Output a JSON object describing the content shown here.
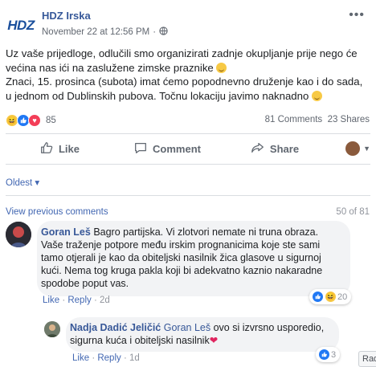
{
  "post": {
    "page_name": "HDZ Irska",
    "logo_text": "HDZ",
    "timestamp": "November 22 at 12:56 PM",
    "more": "•••",
    "text_line1": "Uz vaše prijedloge, odlučili smo organizirati zadnje okupljanje prije nego će većina nas ići na zaslužene zimske praznike",
    "text_line2": "Znaci, 15. prosinca (subota) imat ćemo popodnevno druženje kao i do sada, u jednom od Dublinskih pubova. Točnu lokaciju javimo naknadno",
    "reaction_count": "85",
    "comments_count": "81 Comments",
    "shares_count": "23 Shares"
  },
  "actions": {
    "like": "Like",
    "comment": "Comment",
    "share": "Share"
  },
  "comments_section": {
    "sort_label": "Oldest ▾",
    "view_previous": "View previous comments",
    "count": "50 of 81"
  },
  "comment1": {
    "author": "Goran Leš",
    "text": "Bagro partijska. Vi zlotvori nemate ni truna obraza. Vaše traženje potpore među irskim prognanicima koje ste sami tamo otjerali je kao da obiteljski nasilnik žica glasove u sigurnoj kući. Nema tog kruga pakla koji bi adekvatno kaznio nakaradne spodobe poput vas.",
    "like": "Like",
    "reply": "Reply",
    "time": "2d",
    "reaction_count": "20"
  },
  "comment2": {
    "author": "Nadja Dadić Jeličić",
    "mention": "Goran Leš",
    "text": "ovo si izvrsno usporedio, sigurna kuća i obiteljski nasilnik",
    "heart": "❤",
    "like": "Like",
    "reply": "Reply",
    "time": "1d",
    "reaction_count": "3"
  },
  "side_button": "Rad",
  "colors": {
    "link": "#4267b2",
    "author": "#385898",
    "bubble": "#f2f3f5"
  }
}
